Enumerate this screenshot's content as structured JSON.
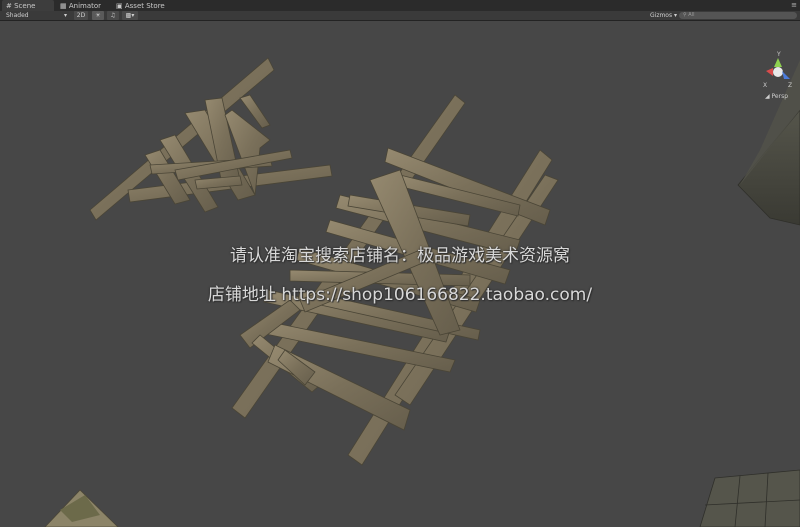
{
  "tabs": [
    {
      "label": "Scene",
      "icon": "scene-icon"
    },
    {
      "label": "Animator",
      "icon": "animator-icon"
    },
    {
      "label": "Asset Store",
      "icon": "asset-store-icon"
    }
  ],
  "toolbar": {
    "shading_mode": "Shaded",
    "mode_2d": "2D",
    "gizmos_label": "Gizmos",
    "search_placeholder": "All"
  },
  "scene_gizmo": {
    "projection_label": "Persp",
    "axis_labels": [
      "Y",
      "X",
      "Z"
    ]
  },
  "watermark": {
    "line1": "请认准淘宝搜索店铺名：极品游戏美术资源窝",
    "line2": "店铺地址 https://shop106166822.taobao.com/"
  },
  "colors": {
    "background": "#474747",
    "tabbar": "#2b2b2b",
    "toolbar": "#3a3a3a",
    "wood": "#8a7f67"
  }
}
